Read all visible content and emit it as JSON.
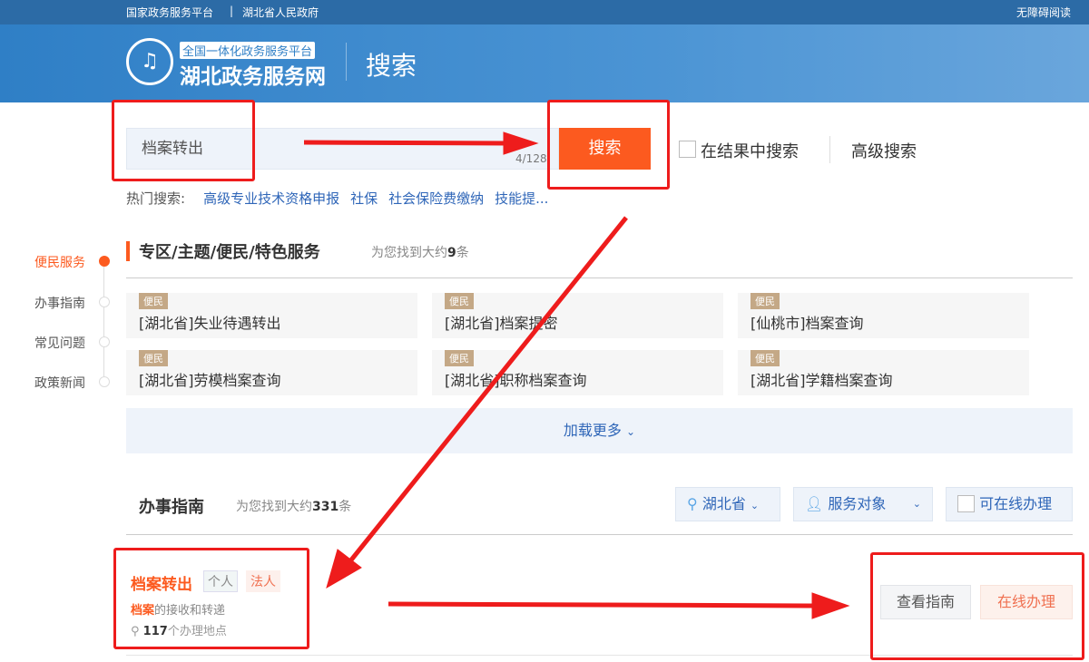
{
  "topbar": {
    "link1": "国家政务服务平台",
    "sep": "|",
    "link2": "湖北省人民政府",
    "accessibility": "无障碍阅读"
  },
  "header": {
    "logo_small": "全国一体化政务服务平台",
    "logo_main": "湖北政务服务网",
    "page": "搜索"
  },
  "search": {
    "value": "档案转出",
    "counter": "4/128",
    "button": "搜索",
    "in_results": "在结果中搜索",
    "advanced": "高级搜索"
  },
  "hot": {
    "label": "热门搜索:",
    "items": [
      "高级专业技术资格申报",
      "社保",
      "社会保险费缴纳",
      "技能提..."
    ]
  },
  "sidenav": [
    "便民服务",
    "办事指南",
    "常见问题",
    "政策新闻"
  ],
  "section1": {
    "title": "专区/主题/便民/特色服务",
    "sub_prefix": "为您找到大约",
    "count": "9",
    "sub_suffix": "条",
    "cards": [
      {
        "tag": "便民",
        "text": "[湖北省]失业待遇转出"
      },
      {
        "tag": "便民",
        "text": "[湖北省]档案提密"
      },
      {
        "tag": "便民",
        "text": "[仙桃市]档案查询"
      },
      {
        "tag": "便民",
        "text": "[湖北省]劳模档案查询"
      },
      {
        "tag": "便民",
        "text": "[湖北省]职称档案查询"
      },
      {
        "tag": "便民",
        "text": "[湖北省]学籍档案查询"
      }
    ],
    "load_more": "加载更多"
  },
  "section2": {
    "title": "办事指南",
    "sub_prefix": "为您找到大约",
    "count": "331",
    "sub_suffix": "条",
    "filters": {
      "region": "湖北省",
      "target": "服务对象",
      "online": "可在线办理"
    },
    "result": {
      "title": "档案转出",
      "tag1": "个人",
      "tag2": "法人",
      "desc_hl": "档案",
      "desc": "的接收和转递",
      "loc_count": "117",
      "loc_text": "个办理地点",
      "btn_guide": "查看指南",
      "btn_online": "在线办理"
    }
  },
  "colors": {
    "accent": "#fc5a1f",
    "link": "#2f66b8",
    "annotation": "#ee1c1c"
  }
}
